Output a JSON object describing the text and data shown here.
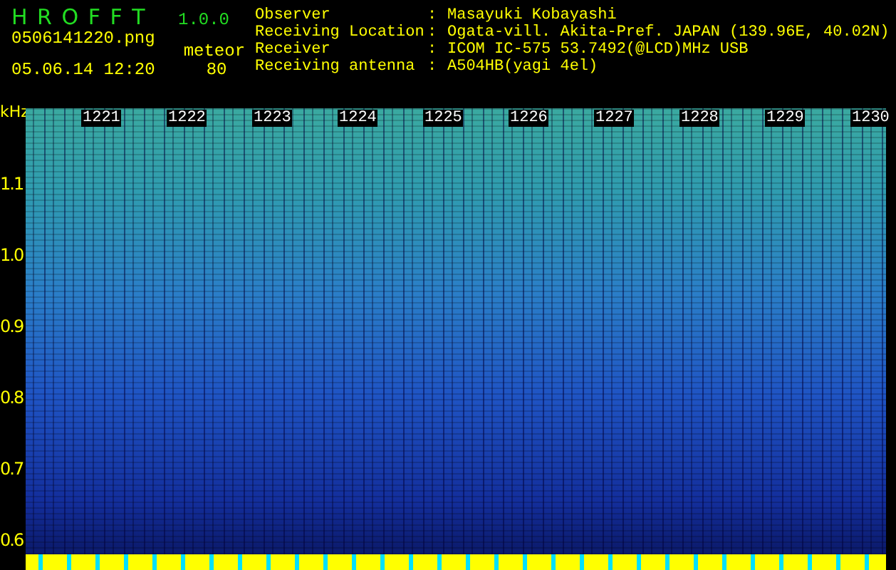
{
  "app": {
    "name": "H R O F F T",
    "version": "1.0.0",
    "file": "0506141220.png",
    "datetime": "05.06.14 12:20",
    "mode_label": "meteor",
    "mode_value": "80"
  },
  "info": [
    {
      "label": "Observer",
      "separator": ":",
      "value": "Masayuki Kobayashi"
    },
    {
      "label": "Receiving Location",
      "separator": ":",
      "value": "Ogata-vill. Akita-Pref. JAPAN (139.96E, 40.02N)"
    },
    {
      "label": "Receiver",
      "separator": ":",
      "value": "ICOM IC-575 53.7492(@LCD)MHz USB"
    },
    {
      "label": "Receiving antenna",
      "separator": ":",
      "value": "A504HB(yagi 4el)"
    }
  ],
  "spectrogram": {
    "y_unit": "kHz",
    "y_labels": [
      "1.1",
      "1.0",
      "0.9",
      "0.8",
      "0.7",
      "0.6"
    ],
    "x_labels": [
      "1221",
      "1222",
      "1223",
      "1224",
      "1225",
      "1226",
      "1227",
      "1228",
      "1229",
      "1230"
    ]
  }
}
